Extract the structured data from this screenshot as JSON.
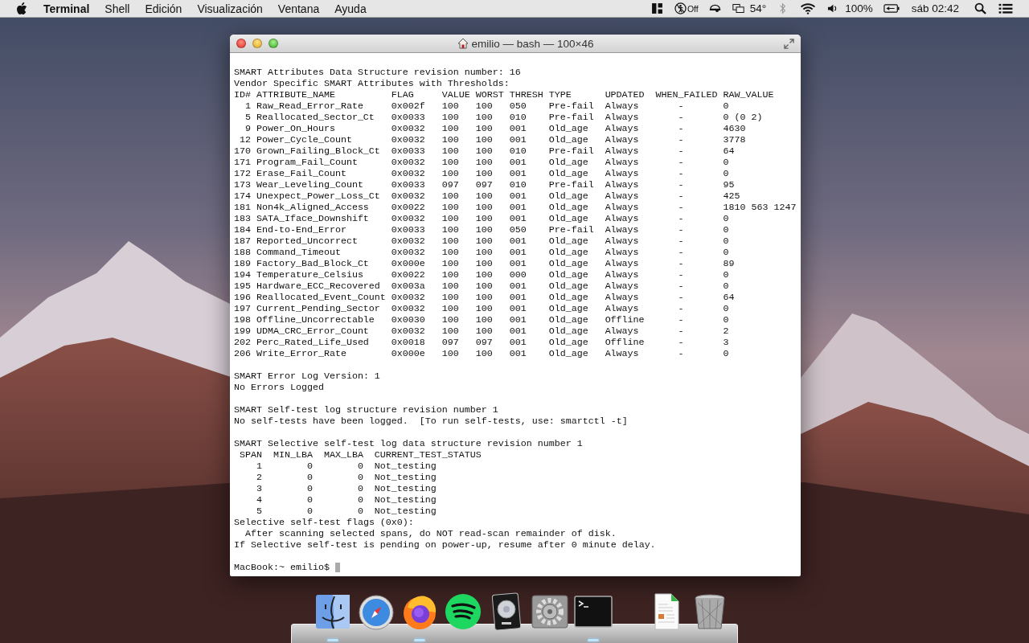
{
  "menu_bar": {
    "app_name": "Terminal",
    "menus": [
      "Shell",
      "Edición",
      "Visualización",
      "Ventana",
      "Ayuda"
    ],
    "status": {
      "accessibility": "Off",
      "temperature": "54°",
      "battery": "100%",
      "clock": "sáb 02:42"
    }
  },
  "window": {
    "title": "emilio — bash — 100×46",
    "blocks": [
      [
        {
          "kind": "line",
          "text": "SMART Attributes Data Structure revision number: 16"
        },
        {
          "kind": "line",
          "text": "Vendor Specific SMART Attributes with Thresholds:"
        },
        {
          "kind": "attribute_table",
          "columns": [
            "ID#",
            "ATTRIBUTE_NAME",
            "FLAG",
            "VALUE",
            "WORST",
            "THRESH",
            "TYPE",
            "UPDATED",
            "WHEN_FAILED",
            "RAW_VALUE"
          ],
          "rows": [
            [
              "1",
              "Raw_Read_Error_Rate",
              "0x002f",
              "100",
              "100",
              "050",
              "Pre-fail",
              "Always",
              "-",
              "0"
            ],
            [
              "5",
              "Reallocated_Sector_Ct",
              "0x0033",
              "100",
              "100",
              "010",
              "Pre-fail",
              "Always",
              "-",
              "0 (0 2)"
            ],
            [
              "9",
              "Power_On_Hours",
              "0x0032",
              "100",
              "100",
              "001",
              "Old_age",
              "Always",
              "-",
              "4630"
            ],
            [
              "12",
              "Power_Cycle_Count",
              "0x0032",
              "100",
              "100",
              "001",
              "Old_age",
              "Always",
              "-",
              "3778"
            ],
            [
              "170",
              "Grown_Failing_Block_Ct",
              "0x0033",
              "100",
              "100",
              "010",
              "Pre-fail",
              "Always",
              "-",
              "64"
            ],
            [
              "171",
              "Program_Fail_Count",
              "0x0032",
              "100",
              "100",
              "001",
              "Old_age",
              "Always",
              "-",
              "0"
            ],
            [
              "172",
              "Erase_Fail_Count",
              "0x0032",
              "100",
              "100",
              "001",
              "Old_age",
              "Always",
              "-",
              "0"
            ],
            [
              "173",
              "Wear_Leveling_Count",
              "0x0033",
              "097",
              "097",
              "010",
              "Pre-fail",
              "Always",
              "-",
              "95"
            ],
            [
              "174",
              "Unexpect_Power_Loss_Ct",
              "0x0032",
              "100",
              "100",
              "001",
              "Old_age",
              "Always",
              "-",
              "425"
            ],
            [
              "181",
              "Non4k_Aligned_Access",
              "0x0022",
              "100",
              "100",
              "001",
              "Old_age",
              "Always",
              "-",
              "1810 563 1247"
            ],
            [
              "183",
              "SATA_Iface_Downshift",
              "0x0032",
              "100",
              "100",
              "001",
              "Old_age",
              "Always",
              "-",
              "0"
            ],
            [
              "184",
              "End-to-End_Error",
              "0x0033",
              "100",
              "100",
              "050",
              "Pre-fail",
              "Always",
              "-",
              "0"
            ],
            [
              "187",
              "Reported_Uncorrect",
              "0x0032",
              "100",
              "100",
              "001",
              "Old_age",
              "Always",
              "-",
              "0"
            ],
            [
              "188",
              "Command_Timeout",
              "0x0032",
              "100",
              "100",
              "001",
              "Old_age",
              "Always",
              "-",
              "0"
            ],
            [
              "189",
              "Factory_Bad_Block_Ct",
              "0x000e",
              "100",
              "100",
              "001",
              "Old_age",
              "Always",
              "-",
              "89"
            ],
            [
              "194",
              "Temperature_Celsius",
              "0x0022",
              "100",
              "100",
              "000",
              "Old_age",
              "Always",
              "-",
              "0"
            ],
            [
              "195",
              "Hardware_ECC_Recovered",
              "0x003a",
              "100",
              "100",
              "001",
              "Old_age",
              "Always",
              "-",
              "0"
            ],
            [
              "196",
              "Reallocated_Event_Count",
              "0x0032",
              "100",
              "100",
              "001",
              "Old_age",
              "Always",
              "-",
              "64"
            ],
            [
              "197",
              "Current_Pending_Sector",
              "0x0032",
              "100",
              "100",
              "001",
              "Old_age",
              "Always",
              "-",
              "0"
            ],
            [
              "198",
              "Offline_Uncorrectable",
              "0x0030",
              "100",
              "100",
              "001",
              "Old_age",
              "Offline",
              "-",
              "0"
            ],
            [
              "199",
              "UDMA_CRC_Error_Count",
              "0x0032",
              "100",
              "100",
              "001",
              "Old_age",
              "Always",
              "-",
              "2"
            ],
            [
              "202",
              "Perc_Rated_Life_Used",
              "0x0018",
              "097",
              "097",
              "001",
              "Old_age",
              "Offline",
              "-",
              "3"
            ],
            [
              "206",
              "Write_Error_Rate",
              "0x000e",
              "100",
              "100",
              "001",
              "Old_age",
              "Always",
              "-",
              "0"
            ]
          ]
        }
      ],
      [
        {
          "kind": "line",
          "text": "SMART Error Log Version: 1"
        },
        {
          "kind": "line",
          "text": "No Errors Logged"
        }
      ],
      [
        {
          "kind": "line",
          "text": "SMART Self-test log structure revision number 1"
        },
        {
          "kind": "line",
          "text": "No self-tests have been logged.  [To run self-tests, use: smartctl -t]"
        }
      ],
      [
        {
          "kind": "line",
          "text": "SMART Selective self-test log data structure revision number 1"
        },
        {
          "kind": "span_table",
          "columns": [
            "SPAN",
            "MIN_LBA",
            "MAX_LBA",
            "CURRENT_TEST_STATUS"
          ],
          "rows": [
            [
              "1",
              "0",
              "0",
              "Not_testing"
            ],
            [
              "2",
              "0",
              "0",
              "Not_testing"
            ],
            [
              "3",
              "0",
              "0",
              "Not_testing"
            ],
            [
              "4",
              "0",
              "0",
              "Not_testing"
            ],
            [
              "5",
              "0",
              "0",
              "Not_testing"
            ]
          ]
        },
        {
          "kind": "line",
          "text": "Selective self-test flags (0x0):"
        },
        {
          "kind": "line",
          "text": "  After scanning selected spans, do NOT read-scan remainder of disk."
        },
        {
          "kind": "line",
          "text": "If Selective self-test is pending on power-up, resume after 0 minute delay."
        }
      ],
      [
        {
          "kind": "prompt",
          "text": "MacBook:~ emilio$"
        }
      ]
    ]
  },
  "dock": {
    "items": [
      {
        "kind": "finder",
        "running": true
      },
      {
        "kind": "safari",
        "running": false
      },
      {
        "kind": "firefox",
        "running": true
      },
      {
        "kind": "spotify",
        "running": false
      },
      {
        "kind": "logic",
        "running": false
      },
      {
        "kind": "settings",
        "running": false
      },
      {
        "kind": "terminal",
        "running": true
      },
      {
        "kind": "separator"
      },
      {
        "kind": "document",
        "running": false
      },
      {
        "kind": "trash",
        "running": false
      }
    ]
  }
}
